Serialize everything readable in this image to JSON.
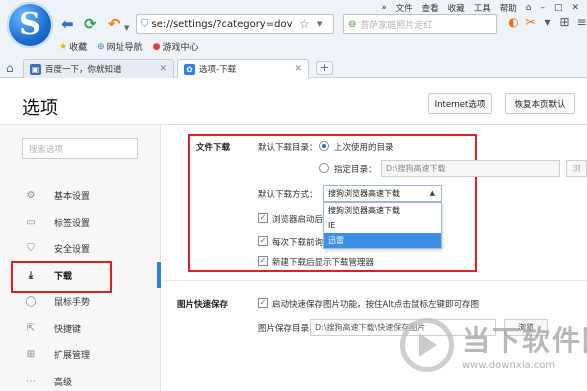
{
  "browser": {
    "logo_letter": "S",
    "top_menu": [
      "»",
      "文件",
      "查看",
      "收藏",
      "工具",
      "帮助"
    ],
    "address_url": "se://settings/?category=dov",
    "search_placeholder": "菩萨家庭照片走红",
    "favorites": [
      {
        "icon": "star-icon",
        "label": "收藏"
      },
      {
        "icon": "globe-icon",
        "label": "网址导航"
      },
      {
        "icon": "game-icon",
        "label": "游戏中心"
      }
    ],
    "tabs": [
      {
        "label": "百度一下，你就知道",
        "active": false
      },
      {
        "label": "选项-下载",
        "active": true
      }
    ],
    "new_tab": "+"
  },
  "settings": {
    "title": "选项",
    "ie_button": "Internet选项",
    "reset_button": "恢复本页默认",
    "sidebar_search_placeholder": "搜索选项",
    "sidebar": [
      {
        "icon": "gear-icon",
        "label": "基本设置"
      },
      {
        "icon": "tab-icon",
        "label": "标签设置"
      },
      {
        "icon": "shield-icon",
        "label": "安全设置"
      },
      {
        "icon": "download-icon",
        "label": "下载",
        "active": true
      },
      {
        "icon": "mouse-icon",
        "label": "鼠标手势"
      },
      {
        "icon": "shortcut-icon",
        "label": "快捷键"
      },
      {
        "icon": "extension-icon",
        "label": "扩展管理"
      },
      {
        "icon": "more-icon",
        "label": "高级"
      }
    ],
    "file_download": {
      "section_label": "文件下载",
      "default_dir_label": "默认下载目录：",
      "option_last_used": "上次使用的目录",
      "option_specify": "指定目录：",
      "specify_path": "D:\\搜狗高速下载",
      "browse_label": "浏",
      "method_label": "默认下载方式：",
      "method_selected": "搜狗浏览器高速下载",
      "method_options": [
        "搜狗浏览器高速下载",
        "IE",
        "迅雷"
      ],
      "method_highlighted": "迅雷",
      "check_start_partial": "浏览器启动后",
      "check_ask_partial": "每次下载前询",
      "check_show_manager": "新建下载后显示下载管理器"
    },
    "image_save": {
      "section_label": "图片快速保存",
      "enable_label": "启动快速保存图片功能，按住Alt点击鼠标左键即可存图",
      "dir_label": "图片保存目录：",
      "dir_value": "D:\\搜狗高速下载\\快速保存图片",
      "browse_label": "浏览"
    }
  },
  "watermark": {
    "brand": "当下软件园",
    "url": "www.downxia.com"
  }
}
